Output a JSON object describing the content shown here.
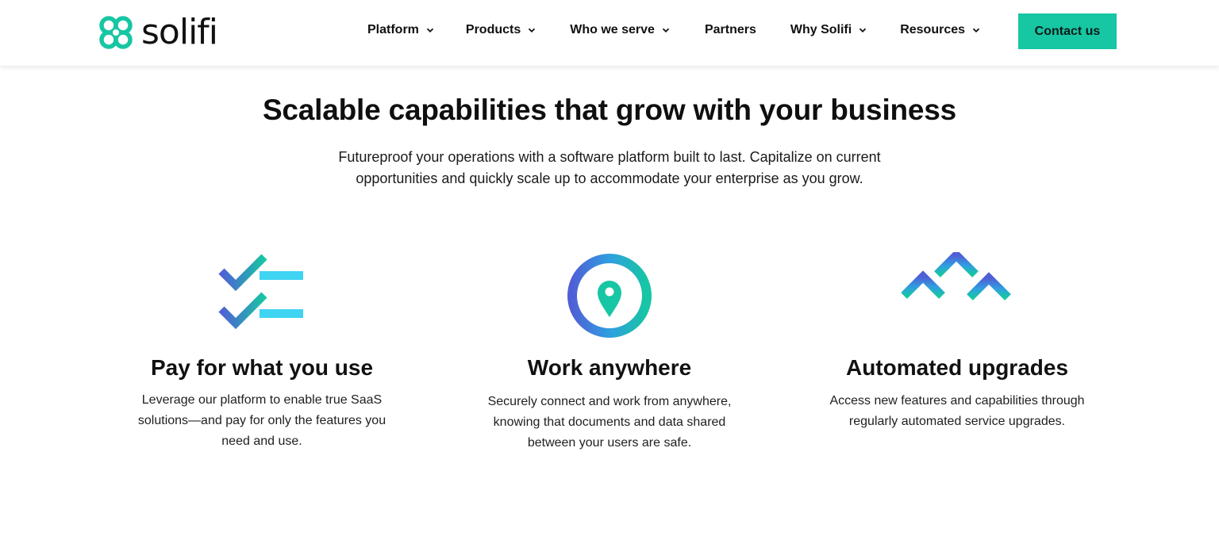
{
  "brand": {
    "name": "solifi",
    "accent_color": "#17c6a3",
    "gradient_start": "#4f5fd6",
    "gradient_end": "#17c6a3"
  },
  "nav": {
    "items": [
      {
        "label": "Platform",
        "has_dropdown": true
      },
      {
        "label": "Products",
        "has_dropdown": true
      },
      {
        "label": "Who we serve",
        "has_dropdown": true
      },
      {
        "label": "Partners",
        "has_dropdown": false
      },
      {
        "label": "Why Solifi",
        "has_dropdown": true
      },
      {
        "label": "Resources",
        "has_dropdown": true
      }
    ],
    "cta_label": "Contact us"
  },
  "hero": {
    "title": "Scalable capabilities that grow with your business",
    "subtitle_line1": "Futureproof your operations with a software platform built to last. Capitalize on current",
    "subtitle_line2": "opportunities and quickly scale up to accommodate your enterprise as you grow."
  },
  "features": [
    {
      "icon": "checklist-icon",
      "title": "Pay for what you use",
      "lines": [
        "Leverage our platform to enable true SaaS",
        "solutions—and pay for only the features you",
        "need and use."
      ]
    },
    {
      "icon": "location-pin-icon",
      "title": "Work anywhere",
      "lines": [
        "Securely connect and work from anywhere,",
        "knowing that documents and data shared",
        "between your users are safe."
      ]
    },
    {
      "icon": "upgrade-arrows-icon",
      "title": "Automated upgrades",
      "lines": [
        "Access new features and capabilities through",
        "regularly automated service upgrades."
      ]
    }
  ]
}
